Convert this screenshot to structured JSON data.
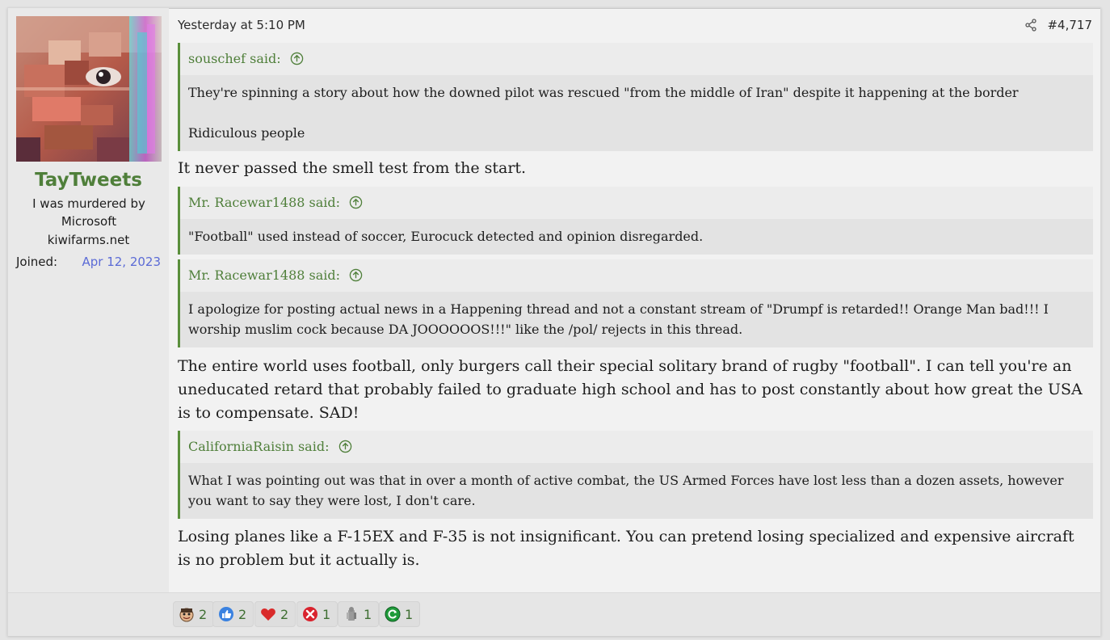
{
  "post": {
    "date": "Yesterday at 5:10 PM",
    "number": "#4,717"
  },
  "user": {
    "name": "TayTweets",
    "title": "I was murdered by Microsoft",
    "site": "kiwifarms.net",
    "joined_label": "Joined:",
    "joined_value": "Apr 12, 2023"
  },
  "quotes": [
    {
      "author": "souschef said:",
      "lines": [
        "They're spinning a story about how the downed pilot was rescued \"from the middle of Iran\" despite it happening at the border",
        "Ridiculous people"
      ]
    },
    {
      "author": "Mr. Racewar1488 said:",
      "lines": [
        "\"Football\" used instead of soccer, Eurocuck detected and opinion disregarded."
      ]
    },
    {
      "author": "Mr. Racewar1488 said:",
      "lines": [
        "I apologize for posting actual news in a Happening thread and not a constant stream of \"Drumpf is retarded!! Orange Man bad!!! I worship muslim cock because DA JOOOOOOS!!!\" like the /pol/ rejects in this thread."
      ]
    },
    {
      "author": "CaliforniaRaisin said:",
      "lines": [
        "What I was pointing out was that in over a month of active combat, the US Armed Forces have lost less than a dozen assets, however you want to say they were lost, I don't care."
      ]
    }
  ],
  "replies": [
    "It never passed the smell test from the start.",
    "The entire world uses football, only burgers call their special solitary brand of rugby \"football\". I can tell you're an uneducated retard that probably failed to graduate high school and has to post constantly about how great the USA is to compensate. SAD!",
    "Losing planes like a F-15EX and F-35 is not insignificant. You can pretend losing specialized and expensive aircraft is no problem but it actually is."
  ],
  "reactions": [
    {
      "icon": "face-icon",
      "count": "2"
    },
    {
      "icon": "thumbs-up-icon",
      "count": "2"
    },
    {
      "icon": "heart-icon",
      "count": "2"
    },
    {
      "icon": "x-icon",
      "count": "1"
    },
    {
      "icon": "gray-figure-icon",
      "count": "1"
    },
    {
      "icon": "green-refresh-icon",
      "count": "1"
    }
  ],
  "colors": {
    "username": "#4f7f3a",
    "quote_border": "#5a8f3c",
    "joined_date": "#5b6bd6",
    "reaction_count": "#3f6f33"
  }
}
